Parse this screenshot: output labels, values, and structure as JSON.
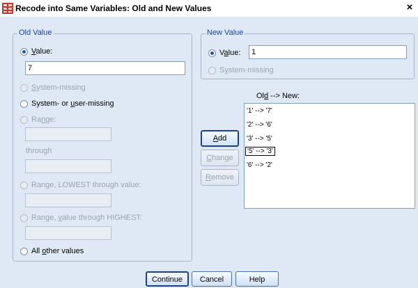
{
  "window": {
    "title": "Recode into Same Variables: Old and New Values",
    "close_glyph": "×",
    "icon": "spss-grid-icon"
  },
  "old_value": {
    "legend": "Old Value",
    "value_label_pre": "",
    "value_label_u": "V",
    "value_label_post": "alue:",
    "value_input": "7",
    "system_missing_u": "S",
    "system_missing_post": "ystem-missing",
    "sys_user_missing_pre": "System- or ",
    "sys_user_missing_u": "u",
    "sys_user_missing_post": "ser-missing",
    "range_pre": "Ra",
    "range_u": "n",
    "range_post": "ge:",
    "through_label": "through",
    "range_lowest_pre": "Range, LOWEST through value:",
    "range_highest_pre": "Range, ",
    "range_highest_u": "v",
    "range_highest_post": "alue through HIGHEST:",
    "all_other_pre": "All ",
    "all_other_u": "o",
    "all_other_post": "ther values"
  },
  "new_value": {
    "legend": "New Value",
    "value_label_u": "a",
    "value_label_pre": "V",
    "value_label_post": "lue:",
    "value_input": "1",
    "system_missing_pre": "S",
    "system_missing_u": "y",
    "system_missing_post": "stem-missing"
  },
  "mapping": {
    "header_pre": "Ol",
    "header_u": "d",
    "header_post": " --> New:",
    "items": [
      "'1' --> '7'",
      "'2' --> '6'",
      "'3' --> '5'",
      "'5' --> '3'",
      "'6' --> '2'"
    ],
    "selected_index": 3
  },
  "buttons": {
    "add_u": "A",
    "add_post": "dd",
    "change_u": "C",
    "change_post": "hange",
    "remove_u": "R",
    "remove_post": "emove",
    "continue": "Continue",
    "cancel": "Cancel",
    "help": "Help"
  }
}
